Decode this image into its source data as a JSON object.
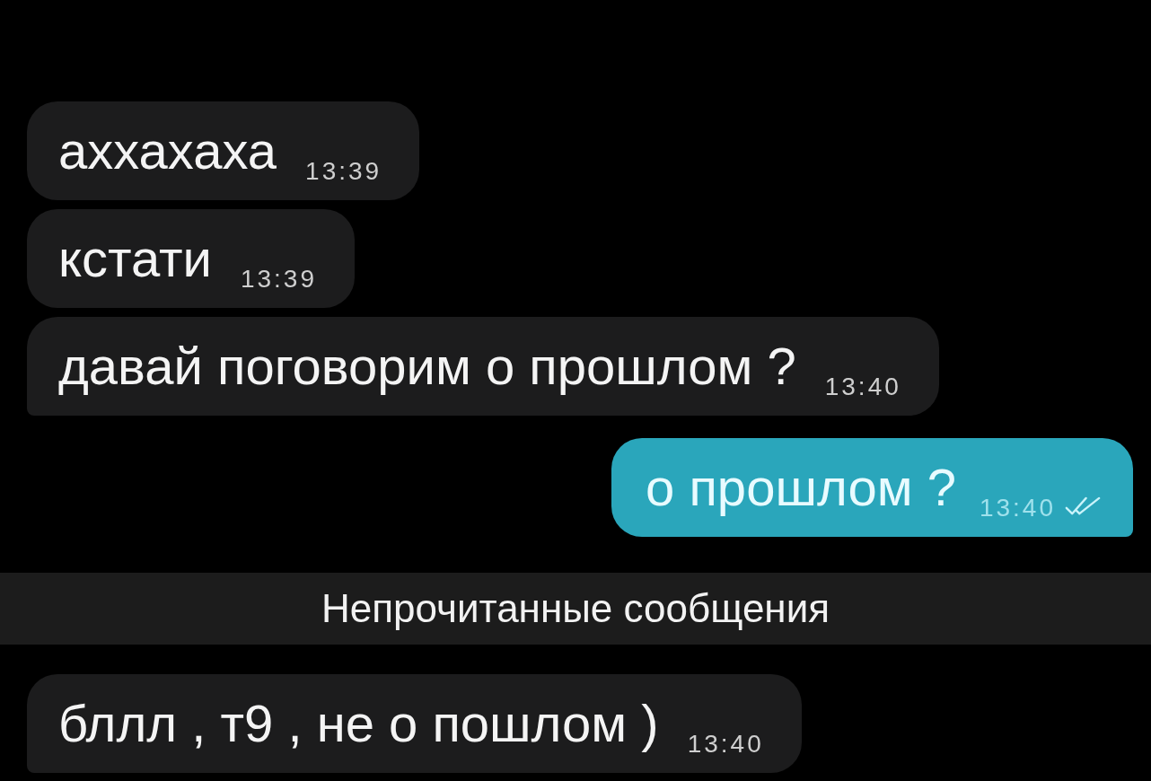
{
  "items": [
    {
      "kind": "incoming",
      "text": "аххахаха",
      "time": "13:39"
    },
    {
      "kind": "incoming",
      "text": "кстати",
      "time": "13:39"
    },
    {
      "kind": "incoming",
      "text": "давай поговорим о прошлом ?",
      "time": "13:40"
    },
    {
      "kind": "outgoing",
      "text": "о прошлом ?",
      "time": "13:40",
      "read": true
    },
    {
      "kind": "unread_divider",
      "text": "Непрочитанные сообщения"
    },
    {
      "kind": "incoming",
      "text": "бллл , т9 , не о пошлом )",
      "time": "13:40"
    }
  ]
}
